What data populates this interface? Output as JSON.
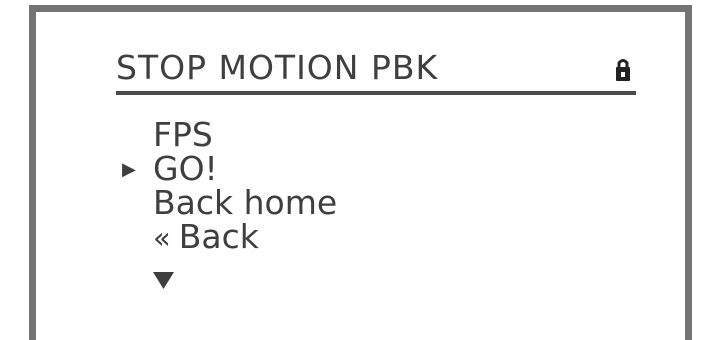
{
  "header": {
    "title": "STOP MOTION PBK"
  },
  "menu": {
    "items": [
      {
        "label": "FPS",
        "selected": false
      },
      {
        "label": "GO!",
        "selected": true
      },
      {
        "label": "Back home",
        "selected": false
      },
      {
        "label": "Back",
        "selected": false
      }
    ]
  },
  "icons": {
    "lock": "lock-icon",
    "cursor": "right-triangle-icon",
    "back": "double-left-chevron-icon",
    "more": "down-triangle-icon"
  },
  "colors": {
    "background": "#ffffff",
    "frame": "#747474",
    "text": "#3f3f3f",
    "underline": "#4b4b4b"
  }
}
